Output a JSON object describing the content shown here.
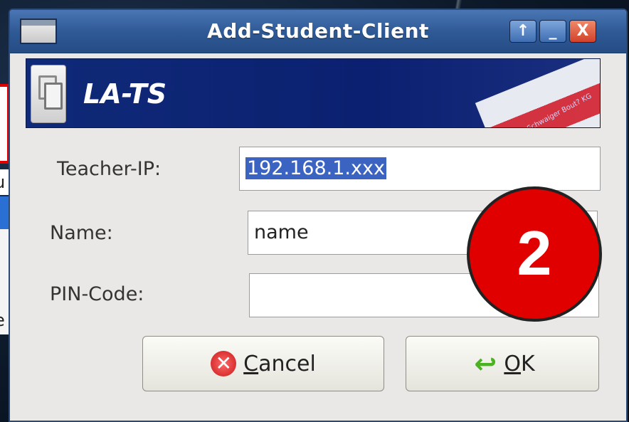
{
  "window": {
    "title": "Add-Student-Client",
    "buttons": {
      "up": "↑",
      "minimize": "_",
      "close": "X"
    }
  },
  "banner": {
    "title": "LA-TS",
    "small_text": "Wolf & Schwaiger Bout? KG"
  },
  "form": {
    "teacher_ip_label": "Teacher-IP:",
    "teacher_ip_value": "192.168.1.xxx",
    "name_label": "Name:",
    "name_value": "name",
    "pin_label": "PIN-Code:",
    "pin_value": ""
  },
  "buttons": {
    "cancel_label_first": "C",
    "cancel_label_rest": "ancel",
    "ok_label_first": "O",
    "ok_label_rest": "K"
  },
  "annotation": {
    "number": "2"
  },
  "background": {
    "text1": "u",
    "text2": "e"
  },
  "colors": {
    "badge": "#e00000",
    "titlebar": "#2f5a96",
    "banner": "#0f2a78",
    "selection": "#3a63c2"
  },
  "icons": {
    "cancel": "cancel-icon",
    "ok": "ok-icon",
    "app": "app-icon",
    "logo": "logo-icon"
  }
}
